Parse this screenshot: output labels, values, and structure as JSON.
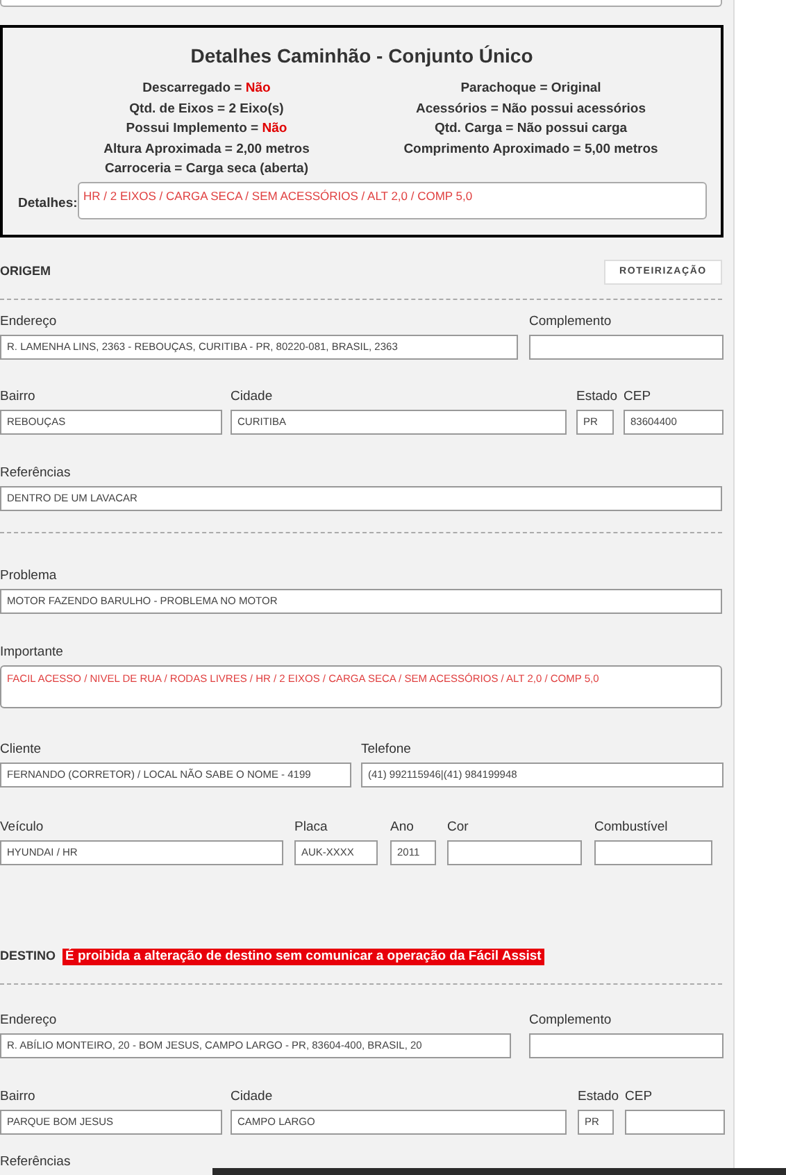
{
  "details": {
    "title": "Detalhes Caminhão - Conjunto Único",
    "left": [
      {
        "label": "Descarregado = ",
        "value": "Não",
        "alert": true
      },
      {
        "label": "Qtd. de Eixos = ",
        "value": "2 Eixo(s)",
        "alert": false
      },
      {
        "label": "Possui Implemento = ",
        "value": "Não",
        "alert": true
      },
      {
        "label": "Altura Aproximada = ",
        "value": "2,00 metros",
        "alert": false
      },
      {
        "label": "Carroceria = ",
        "value": "Carga seca (aberta)",
        "alert": false
      }
    ],
    "right": [
      {
        "label": "Parachoque = ",
        "value": "Original",
        "alert": false
      },
      {
        "label": "Acessórios = ",
        "value": "Não possui acessórios",
        "alert": false
      },
      {
        "label": "Qtd. Carga = ",
        "value": "Não possui carga",
        "alert": false
      },
      {
        "label": "Comprimento Aproximado = ",
        "value": "5,00 metros",
        "alert": false
      }
    ],
    "notes_label": "Detalhes:",
    "notes": "HR / 2 EIXOS / CARGA SECA / SEM ACESSÓRIOS / ALT 2,0 / COMP 5,0"
  },
  "blocks": [
    {
      "kind": "header",
      "title": "ORIGEM",
      "button": "ROTEIRIZAÇÃO"
    },
    {
      "kind": "divider"
    },
    {
      "kind": "row",
      "fields": [
        {
          "label": "Endereço",
          "value": "R. LAMENHA LINS, 2363 - REBOUÇAS, CURITIBA - PR, 80220-081, BRASIL, 2363"
        },
        {
          "label": "Complemento"
        }
      ]
    },
    {
      "kind": "row",
      "fields": [
        {
          "label": "Bairro",
          "value": "REBOUÇAS"
        },
        {
          "label": "Cidade",
          "value": "CURITIBA"
        },
        {
          "label": "Estado",
          "value": "PR"
        },
        {
          "label": "CEP",
          "value": "83604400"
        }
      ]
    },
    {
      "kind": "row",
      "fields": [
        {
          "label": "Referências",
          "value": "DENTRO DE UM LAVACAR"
        }
      ]
    },
    {
      "kind": "divider"
    },
    {
      "kind": "row",
      "fields": [
        {
          "label": "Problema",
          "value": "MOTOR FAZENDO BARULHO - PROBLEMA NO MOTOR"
        }
      ]
    },
    {
      "kind": "row",
      "fields": [
        {
          "label": "Importante",
          "value": "FACIL ACESSO / NIVEL DE RUA / RODAS LIVRES / HR / 2 EIXOS / CARGA SECA / SEM ACESSÓRIOS / ALT 2,0 / COMP 5,0",
          "multiline": true
        }
      ]
    },
    {
      "kind": "row",
      "fields": [
        {
          "label": "Cliente",
          "value": "FERNANDO (CORRETOR) / LOCAL NÃO SABE O NOME - 4199"
        },
        {
          "label": "Telefone",
          "value": "(41) 992115946|(41) 984199948"
        }
      ]
    },
    {
      "kind": "row",
      "fields": [
        {
          "label": "Veículo",
          "value": "HYUNDAI / HR"
        },
        {
          "label": "Placa",
          "value": "AUK-XXXX"
        },
        {
          "label": "Ano",
          "value": "2011"
        },
        {
          "label": "Cor"
        },
        {
          "label": "Combustível"
        }
      ]
    },
    {
      "kind": "header",
      "title": "DESTINO",
      "warning": "É proibida a alteração de destino sem comunicar a operação da Fácil Assist"
    },
    {
      "kind": "divider"
    },
    {
      "kind": "row",
      "fields": [
        {
          "label": "Endereço",
          "value": "R. ABÍLIO MONTEIRO, 20 - BOM JESUS, CAMPO LARGO - PR, 83604-400, BRASIL, 20"
        },
        {
          "label": "Complemento"
        }
      ]
    },
    {
      "kind": "row",
      "fields": [
        {
          "label": "Bairro",
          "value": "PARQUE BOM JESUS"
        },
        {
          "label": "Cidade",
          "value": "CAMPO LARGO"
        },
        {
          "label": "Estado",
          "value": "PR"
        },
        {
          "label": "CEP"
        }
      ]
    },
    {
      "kind": "label",
      "label": "Referências"
    }
  ]
}
